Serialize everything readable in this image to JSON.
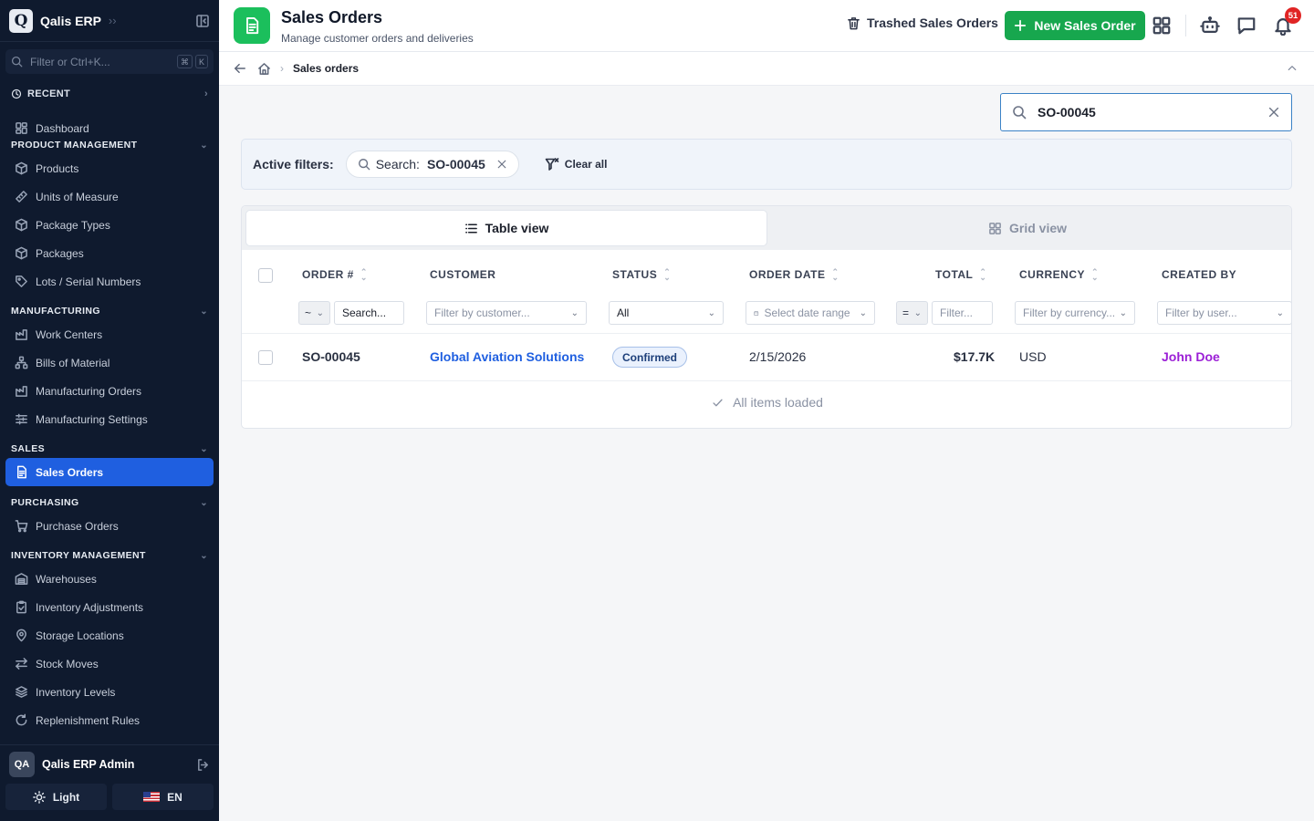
{
  "app": {
    "logo_letter": "Q",
    "name": "Qalis ERP"
  },
  "sidebar": {
    "filter_placeholder": "Filter or Ctrl+K...",
    "shortcut_keys": [
      "⌘",
      "K"
    ],
    "recent_label": "RECENT",
    "dashboard": "Dashboard",
    "sections": {
      "product_management": "PRODUCT MANAGEMENT",
      "manufacturing": "MANUFACTURING",
      "sales": "SALES",
      "purchasing": "PURCHASING",
      "inventory_management": "INVENTORY MANAGEMENT"
    },
    "items": {
      "products": "Products",
      "units_of_measure": "Units of Measure",
      "package_types": "Package Types",
      "packages": "Packages",
      "lots_serial": "Lots / Serial Numbers",
      "work_centers": "Work Centers",
      "bills_of_material": "Bills of Material",
      "manufacturing_orders": "Manufacturing Orders",
      "manufacturing_settings": "Manufacturing Settings",
      "sales_orders": "Sales Orders",
      "purchase_orders": "Purchase Orders",
      "warehouses": "Warehouses",
      "inventory_adjustments": "Inventory Adjustments",
      "storage_locations": "Storage Locations",
      "stock_moves": "Stock Moves",
      "inventory_levels": "Inventory Levels",
      "replenishment_rules": "Replenishment Rules"
    },
    "user": {
      "initials": "QA",
      "name": "Qalis ERP Admin"
    },
    "theme_label": "Light",
    "language_label": "EN"
  },
  "header": {
    "title": "Sales Orders",
    "subtitle": "Manage customer orders and deliveries",
    "trashed_label": "Trashed Sales Orders",
    "new_label": "New Sales Order",
    "notification_count": "51"
  },
  "breadcrumb": {
    "current": "Sales orders"
  },
  "search": {
    "value": "SO-00045"
  },
  "filters": {
    "label": "Active filters:",
    "chip_key": "Search:",
    "chip_value": "SO-00045",
    "clear_all": "Clear all"
  },
  "views": {
    "table": "Table view",
    "grid": "Grid view"
  },
  "table": {
    "columns": {
      "order": "ORDER #",
      "customer": "CUSTOMER",
      "status": "STATUS",
      "order_date": "ORDER DATE",
      "total": "TOTAL",
      "currency": "CURRENCY",
      "created_by": "CREATED BY"
    },
    "filters": {
      "order_op": "~",
      "order_ph": "Search...",
      "customer_ph": "Filter by customer...",
      "status_val": "All",
      "date_ph": "Select date range",
      "total_op": "=",
      "total_ph": "Filter...",
      "currency_ph": "Filter by currency...",
      "user_ph": "Filter by user..."
    },
    "rows": [
      {
        "order": "SO-00045",
        "customer": "Global Aviation Solutions",
        "status": "Confirmed",
        "order_date": "2/15/2026",
        "total": "$17.7K",
        "currency": "USD",
        "created_by": "John Doe"
      }
    ],
    "footer": "All items loaded"
  },
  "colors": {
    "sidebar_bg": "#0f1a2e",
    "active_nav": "#1f5fe0",
    "primary_button": "#17a74e",
    "page_icon": "#1bbf5c",
    "link": "#1f5fe0",
    "user_link": "#9b1fd6",
    "badge": "#e02424"
  }
}
